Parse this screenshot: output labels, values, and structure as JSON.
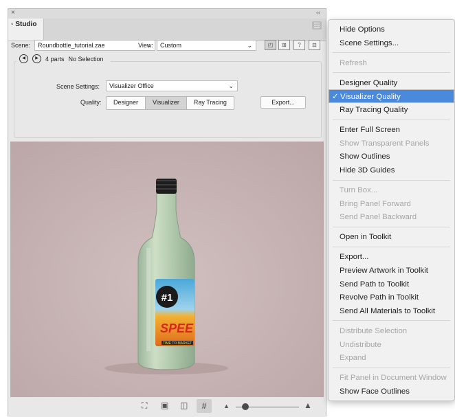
{
  "panel": {
    "close_glyph": "×",
    "collapse_glyph": "‹‹",
    "tab_label": "◦ Studio",
    "scene_label": "Scene:",
    "scene_value": "Roundbottle_tutorial.zae",
    "view_label": "View:",
    "view_value": "Custom",
    "parts_count": "4 parts",
    "selection": "No Selection",
    "scene_settings_label": "Scene Settings:",
    "scene_settings_value": "Visualizer Office",
    "quality_label": "Quality:",
    "quality_options": [
      "Designer",
      "Visualizer",
      "Ray Tracing"
    ],
    "quality_selected": "Visualizer",
    "export_button": "Export..."
  },
  "viewport": {
    "background": "#c7b3b4",
    "label_number": "#1",
    "label_brand": "SPEE",
    "label_tagline": "TIME TO MARKET"
  },
  "menu": {
    "groups": [
      [
        {
          "label": "Hide Options",
          "enabled": true
        },
        {
          "label": "Scene Settings...",
          "enabled": true
        }
      ],
      [
        {
          "label": "Refresh",
          "enabled": false
        }
      ],
      [
        {
          "label": "Designer Quality",
          "enabled": true
        },
        {
          "label": "Visualizer Quality",
          "enabled": true,
          "checked": true,
          "highlighted": true
        },
        {
          "label": "Ray Tracing Quality",
          "enabled": true
        }
      ],
      [
        {
          "label": "Enter Full Screen",
          "enabled": true
        },
        {
          "label": "Show Transparent Panels",
          "enabled": false
        },
        {
          "label": "Show Outlines",
          "enabled": true
        },
        {
          "label": "Hide 3D Guides",
          "enabled": true
        }
      ],
      [
        {
          "label": "Turn Box...",
          "enabled": false
        },
        {
          "label": "Bring Panel Forward",
          "enabled": false
        },
        {
          "label": "Send Panel Backward",
          "enabled": false
        }
      ],
      [
        {
          "label": "Open in Toolkit",
          "enabled": true
        }
      ],
      [
        {
          "label": "Export...",
          "enabled": true
        },
        {
          "label": "Preview Artwork in Toolkit",
          "enabled": true
        },
        {
          "label": "Send Path to Toolkit",
          "enabled": true
        },
        {
          "label": "Revolve Path in Toolkit",
          "enabled": true
        },
        {
          "label": "Send All Materials to Toolkit",
          "enabled": true
        }
      ],
      [
        {
          "label": "Distribute Selection",
          "enabled": false
        },
        {
          "label": "Undistribute",
          "enabled": false
        },
        {
          "label": "Expand",
          "enabled": false
        }
      ],
      [
        {
          "label": "Fit Panel in Document Window",
          "enabled": false
        },
        {
          "label": "Show Face Outlines",
          "enabled": true
        }
      ]
    ],
    "check_glyph": "✓",
    "highlight_color": "#4a89dc"
  }
}
